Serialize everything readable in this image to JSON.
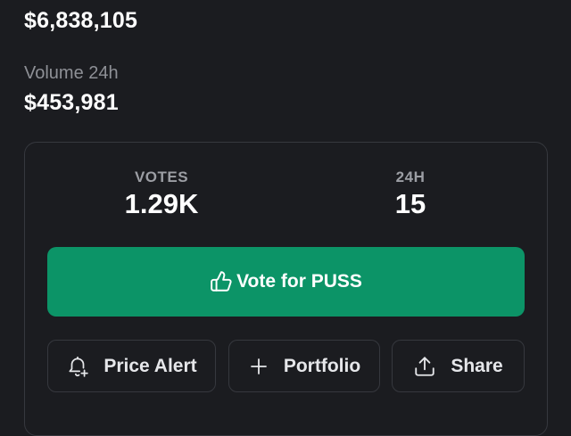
{
  "stats": {
    "market_cap": {
      "value": "$6,838,105"
    },
    "volume": {
      "label": "Volume 24h",
      "value": "$453,981"
    }
  },
  "card": {
    "votes": {
      "label": "VOTES",
      "value": "1.29K"
    },
    "change": {
      "label": "24H",
      "value": "15"
    },
    "vote_button": {
      "label": "Vote for PUSS",
      "icon": "thumbs-up-icon"
    },
    "actions": [
      {
        "label": "Price Alert",
        "icon": "bell-plus-icon"
      },
      {
        "label": "Portfolio",
        "icon": "plus-icon"
      },
      {
        "label": "Share",
        "icon": "share-icon"
      }
    ]
  },
  "colors": {
    "background": "#1b1c20",
    "accent": "#0c9467",
    "border": "#36383e",
    "muted": "#8e9096"
  }
}
